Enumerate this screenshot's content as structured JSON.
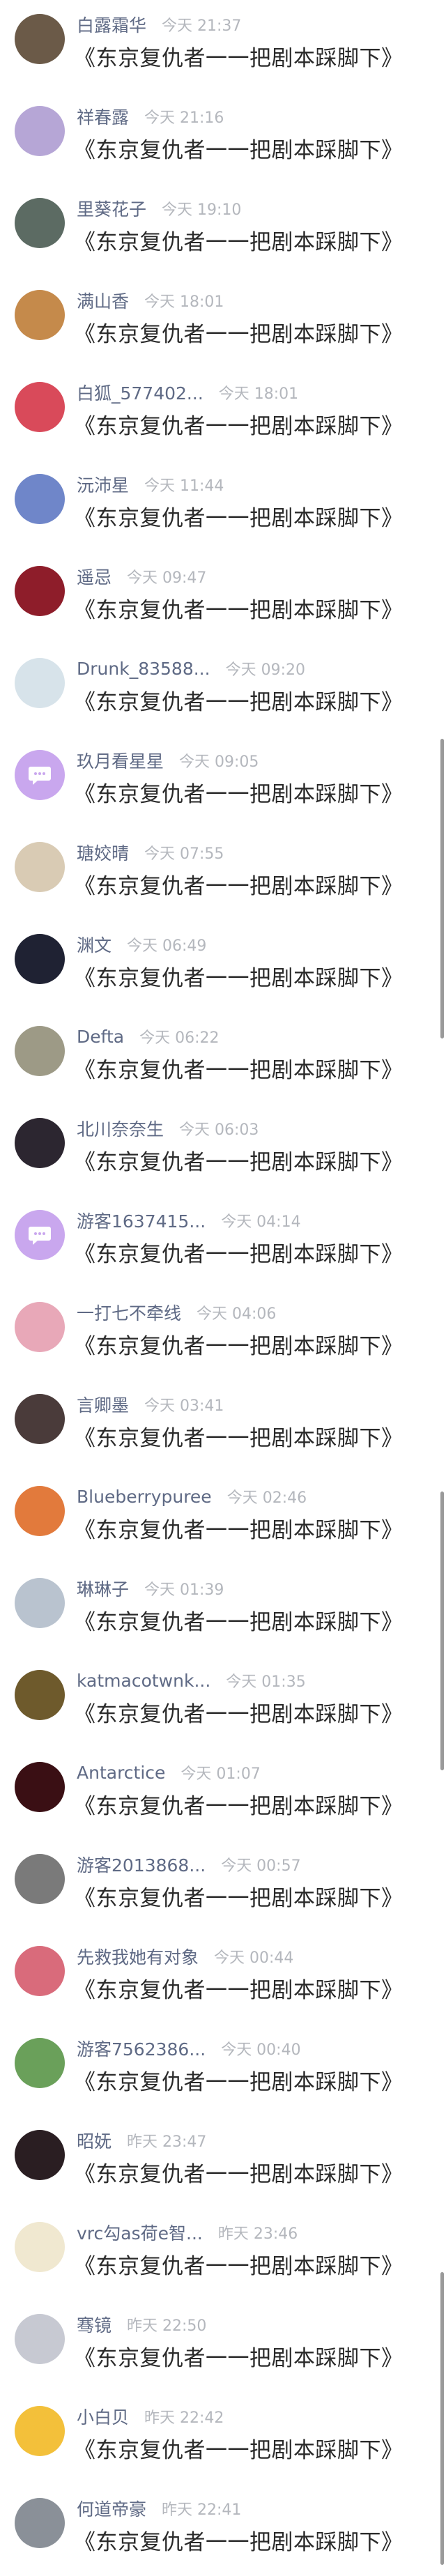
{
  "comments": [
    {
      "name": "白露霜华",
      "time": "今天 21:37",
      "text": "《东京复仇者一一把剧本踩脚下》",
      "avatar_color": "#6b5a48",
      "avatar_icon": "user-avatar"
    },
    {
      "name": "祥春露",
      "time": "今天 21:16",
      "text": "《东京复仇者一一把剧本踩脚下》",
      "avatar_color": "#b6a6d6",
      "avatar_icon": "user-avatar"
    },
    {
      "name": "里葵花子",
      "time": "今天 19:10",
      "text": "《东京复仇者一一把剧本踩脚下》",
      "avatar_color": "#5c6b63",
      "avatar_icon": "user-avatar"
    },
    {
      "name": "满山香",
      "time": "今天 18:01",
      "text": "《东京复仇者一一把剧本踩脚下》",
      "avatar_color": "#c58a4b",
      "avatar_icon": "user-avatar"
    },
    {
      "name": "白狐_577402...",
      "time": "今天 18:01",
      "text": "《东京复仇者一一把剧本踩脚下》",
      "avatar_color": "#d94a5a",
      "avatar_icon": "user-avatar"
    },
    {
      "name": "沅沛星",
      "time": "今天 11:44",
      "text": "《东京复仇者一一把剧本踩脚下》",
      "avatar_color": "#6f86c9",
      "avatar_icon": "user-avatar"
    },
    {
      "name": "遥忌",
      "time": "今天 09:47",
      "text": "《东京复仇者一一把剧本踩脚下》",
      "avatar_color": "#8e1d2a",
      "avatar_icon": "user-avatar"
    },
    {
      "name": "Drunk_83588...",
      "time": "今天 09:20",
      "text": "《东京复仇者一一把剧本踩脚下》",
      "avatar_color": "#d7e3ea",
      "avatar_icon": "user-avatar"
    },
    {
      "name": "玖月看星星",
      "time": "今天 09:05",
      "text": "《东京复仇者一一把剧本踩脚下》",
      "avatar_color": "#c9a7ee",
      "avatar_icon": "chat-bubble-icon"
    },
    {
      "name": "瑭姣晴",
      "time": "今天 07:55",
      "text": "《东京复仇者一一把剧本踩脚下》",
      "avatar_color": "#d9cbb4",
      "avatar_icon": "user-avatar"
    },
    {
      "name": "渊文",
      "time": "今天 06:49",
      "text": "《东京复仇者一一把剧本踩脚下》",
      "avatar_color": "#1f2233",
      "avatar_icon": "user-avatar"
    },
    {
      "name": "Defta",
      "time": "今天 06:22",
      "text": "《东京复仇者一一把剧本踩脚下》",
      "avatar_color": "#9d9a86",
      "avatar_icon": "user-avatar"
    },
    {
      "name": "北川奈奈生",
      "time": "今天 06:03",
      "text": "《东京复仇者一一把剧本踩脚下》",
      "avatar_color": "#2c2630",
      "avatar_icon": "user-avatar"
    },
    {
      "name": "游客1637415...",
      "time": "今天 04:14",
      "text": "《东京复仇者一一把剧本踩脚下》",
      "avatar_color": "#c9a7ee",
      "avatar_icon": "chat-bubble-icon"
    },
    {
      "name": "一打七不牵线",
      "time": "今天 04:06",
      "text": "《东京复仇者一一把剧本踩脚下》",
      "avatar_color": "#e8a8b8",
      "avatar_icon": "user-avatar"
    },
    {
      "name": "言卿墨",
      "time": "今天 03:41",
      "text": "《东京复仇者一一把剧本踩脚下》",
      "avatar_color": "#4a3b3a",
      "avatar_icon": "user-avatar"
    },
    {
      "name": "Blueberrypuree",
      "time": "今天 02:46",
      "text": "《东京复仇者一一把剧本踩脚下》",
      "avatar_color": "#e27a3c",
      "avatar_icon": "user-avatar"
    },
    {
      "name": "琳琳子",
      "time": "今天 01:39",
      "text": "《东京复仇者一一把剧本踩脚下》",
      "avatar_color": "#b9c3cf",
      "avatar_icon": "user-avatar"
    },
    {
      "name": "katmacotwnk...",
      "time": "今天 01:35",
      "text": "《东京复仇者一一把剧本踩脚下》",
      "avatar_color": "#6e5a2c",
      "avatar_icon": "user-avatar"
    },
    {
      "name": "Antarctice",
      "time": "今天 01:07",
      "text": "《东京复仇者一一把剧本踩脚下》",
      "avatar_color": "#3a0f14",
      "avatar_icon": "user-avatar"
    },
    {
      "name": "游客2013868...",
      "time": "今天 00:57",
      "text": "《东京复仇者一一把剧本踩脚下》",
      "avatar_color": "#7a7a7a",
      "avatar_icon": "user-avatar"
    },
    {
      "name": "先救我她有对象",
      "time": "今天 00:44",
      "text": "《东京复仇者一一把剧本踩脚下》",
      "avatar_color": "#d96b7b",
      "avatar_icon": "user-avatar"
    },
    {
      "name": "游客7562386...",
      "time": "今天 00:40",
      "text": "《东京复仇者一一把剧本踩脚下》",
      "avatar_color": "#6aa05a",
      "avatar_icon": "user-avatar"
    },
    {
      "name": "昭妩",
      "time": "昨天 23:47",
      "text": "《东京复仇者一一把剧本踩脚下》",
      "avatar_color": "#2a1e22",
      "avatar_icon": "user-avatar"
    },
    {
      "name": "vrc勾as荷e智...",
      "time": "昨天 23:46",
      "text": "《东京复仇者一一把剧本踩脚下》",
      "avatar_color": "#f0e8d0",
      "avatar_icon": "user-avatar"
    },
    {
      "name": "骞镜",
      "time": "昨天 22:50",
      "text": "《东京复仇者一一把剧本踩脚下》",
      "avatar_color": "#c7c9d2",
      "avatar_icon": "user-avatar"
    },
    {
      "name": "小白贝",
      "time": "昨天 22:42",
      "text": "《东京复仇者一一把剧本踩脚下》",
      "avatar_color": "#f3c03a",
      "avatar_icon": "user-avatar"
    },
    {
      "name": "何道帝豪",
      "time": "昨天 22:41",
      "text": "《东京复仇者一一把剧本踩脚下》",
      "avatar_color": "#8a9098",
      "avatar_icon": "user-avatar"
    }
  ]
}
